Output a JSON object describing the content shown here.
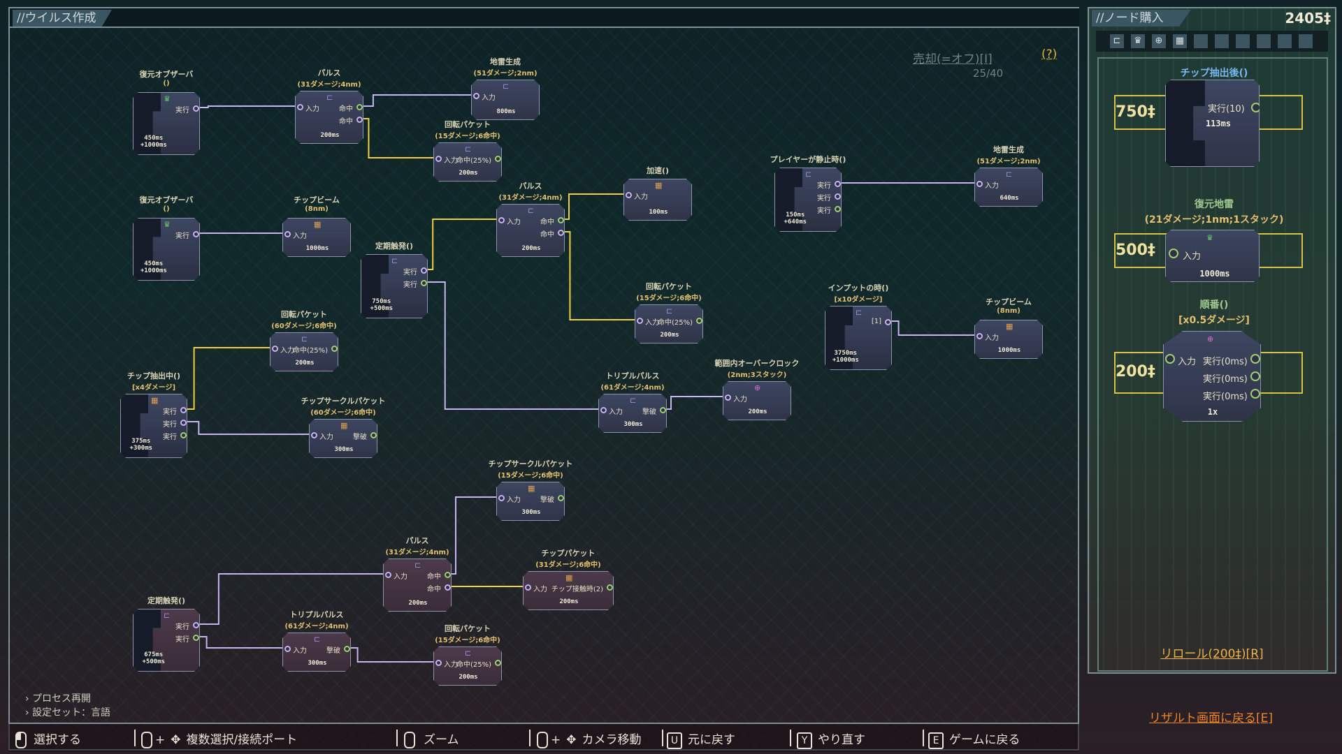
{
  "main_title": "//ウイルス作成",
  "side_title": "//ノード購入",
  "currency": "2405‡",
  "sell_label": "売却(=オフ)[I]",
  "node_count": "25/40",
  "help_label": "(?)",
  "menu": [
    "プロセス再開",
    "設定セット：言語"
  ],
  "hints": [
    {
      "icon": "mouse-left",
      "label": "選択する"
    },
    {
      "icon": "mouse-left-move",
      "label": "複数選択/接続ポート"
    },
    {
      "icon": "mouse-scroll",
      "label": "ズーム"
    },
    {
      "icon": "mouse-right-move",
      "label": "カメラ移動"
    },
    {
      "key": "U",
      "label": "元に戻す"
    },
    {
      "key": "Y",
      "label": "やり直す"
    },
    {
      "key": "E",
      "label": "ゲームに戻る"
    }
  ],
  "shop": {
    "items": [
      {
        "title": "チップ抽出後()",
        "sub": "",
        "price": "750‡",
        "port": "実行(10)",
        "time": "113ms"
      },
      {
        "title": "復元地雷",
        "sub": "(21ダメージ;1nm;1スタック)",
        "price": "500‡",
        "port": "入力",
        "time": "1000ms"
      },
      {
        "title": "順番()",
        "sub": "[x0.5ダメージ]",
        "price": "200‡",
        "port": "入力",
        "outs": [
          "実行(0ms)",
          "実行(0ms)",
          "実行(0ms)"
        ],
        "foot": "1x"
      }
    ],
    "reroll": "リロール(200‡)[R]",
    "return": "リザルト画面に戻る[E]"
  },
  "nodes": [
    {
      "id": "n1",
      "title": "復元オブザーバ",
      "sub": "()",
      "time": "450ms\n+1000ms",
      "outs": [
        "実行"
      ]
    },
    {
      "id": "n2",
      "title": "パルス",
      "sub": "(31ダメージ;4nm)",
      "ins": [
        "入力"
      ],
      "outs": [
        "命中",
        "命中"
      ],
      "time": "200ms"
    },
    {
      "id": "n3",
      "title": "地雷生成",
      "sub": "(51ダメージ;2nm)",
      "ins": [
        "入力"
      ],
      "time": "800ms"
    },
    {
      "id": "n4",
      "title": "回転パケット",
      "sub": "(15ダメージ;6命中)",
      "ins": [
        "入力"
      ],
      "outs": [
        "命中(25%)"
      ],
      "time": "200ms"
    },
    {
      "id": "n5",
      "title": "復元オブザーバ",
      "sub": "()",
      "time": "450ms\n+1000ms",
      "outs": [
        "実行"
      ]
    },
    {
      "id": "n6",
      "title": "チップビーム",
      "sub": "(8nm)",
      "ins": [
        "入力"
      ],
      "time": "1000ms"
    },
    {
      "id": "n7",
      "title": "定期触発()",
      "sub": "",
      "time": "750ms\n+500ms",
      "outs": [
        "実行",
        "実行"
      ]
    },
    {
      "id": "n8",
      "title": "パルス",
      "sub": "(31ダメージ;4nm)",
      "ins": [
        "入力"
      ],
      "outs": [
        "命中",
        "命中"
      ],
      "time": "200ms"
    },
    {
      "id": "n9",
      "title": "加速()",
      "sub": "",
      "ins": [
        "入力"
      ],
      "time": "100ms"
    },
    {
      "id": "n10",
      "title": "回転パケット",
      "sub": "(15ダメージ;6命中)",
      "ins": [
        "入力"
      ],
      "outs": [
        "命中(25%)"
      ],
      "time": "200ms"
    },
    {
      "id": "n11",
      "title": "回転パケット",
      "sub": "(60ダメージ;6命中)",
      "ins": [
        "入力"
      ],
      "outs": [
        "命中(25%)"
      ],
      "time": "200ms"
    },
    {
      "id": "n12",
      "title": "チップ抽出中()",
      "sub": "[x4ダメージ]",
      "time": "375ms\n+300ms",
      "outs": [
        "実行",
        "実行",
        "実行"
      ]
    },
    {
      "id": "n13",
      "title": "チップサークルパケット",
      "sub": "(60ダメージ;6命中)",
      "ins": [
        "入力"
      ],
      "outs": [
        "撃破"
      ],
      "time": "300ms"
    },
    {
      "id": "n14",
      "title": "トリプルパルス",
      "sub": "(61ダメージ;4nm)",
      "ins": [
        "入力"
      ],
      "outs": [
        "撃破"
      ],
      "time": "300ms"
    },
    {
      "id": "n15",
      "title": "範囲内オーバークロック",
      "sub": "(2nm;3スタック)",
      "ins": [
        "入力"
      ],
      "time": "200ms"
    },
    {
      "id": "n16",
      "title": "プレイヤーが静止時()",
      "sub": "",
      "time": "150ms\n+640ms",
      "outs": [
        "実行",
        "実行",
        "実行"
      ]
    },
    {
      "id": "n17",
      "title": "地雷生成",
      "sub": "(51ダメージ;2nm)",
      "ins": [
        "入力"
      ],
      "time": "640ms"
    },
    {
      "id": "n18",
      "title": "インプットの時()",
      "sub": "[x10ダメージ]",
      "time": "3750ms\n+1000ms",
      "outs": [
        "[1]"
      ]
    },
    {
      "id": "n19",
      "title": "チップビーム",
      "sub": "(8nm)",
      "ins": [
        "入力"
      ],
      "time": "1000ms"
    },
    {
      "id": "n20",
      "title": "チップサークルパケット",
      "sub": "(15ダメージ;6命中)",
      "ins": [
        "入力"
      ],
      "outs": [
        "撃破"
      ],
      "time": "300ms"
    },
    {
      "id": "n21",
      "title": "パルス",
      "sub": "(31ダメージ;4nm)",
      "ins": [
        "入力"
      ],
      "outs": [
        "命中",
        "命中"
      ],
      "time": "200ms"
    },
    {
      "id": "n22",
      "title": "チップパケット",
      "sub": "(31ダメージ;6命中)",
      "ins": [
        "入力"
      ],
      "outs": [
        "チップ接触時(2)"
      ],
      "time": "200ms"
    },
    {
      "id": "n23",
      "title": "定期触発()",
      "sub": "",
      "time": "675ms\n+500ms",
      "outs": [
        "実行",
        "実行"
      ]
    },
    {
      "id": "n24",
      "title": "トリプルパルス",
      "sub": "(61ダメージ;4nm)",
      "ins": [
        "入力"
      ],
      "outs": [
        "撃破"
      ],
      "time": "300ms"
    },
    {
      "id": "n25",
      "title": "回転パケット",
      "sub": "(15ダメージ;6命中)",
      "ins": [
        "入力"
      ],
      "outs": [
        "命中(25%)"
      ],
      "time": "200ms"
    }
  ],
  "colors": {
    "wire_purple": "#c8b4f0",
    "wire_yellow": "#f0d040",
    "accent_gold": "#f0e2a0",
    "return_orange": "#f2842a"
  }
}
